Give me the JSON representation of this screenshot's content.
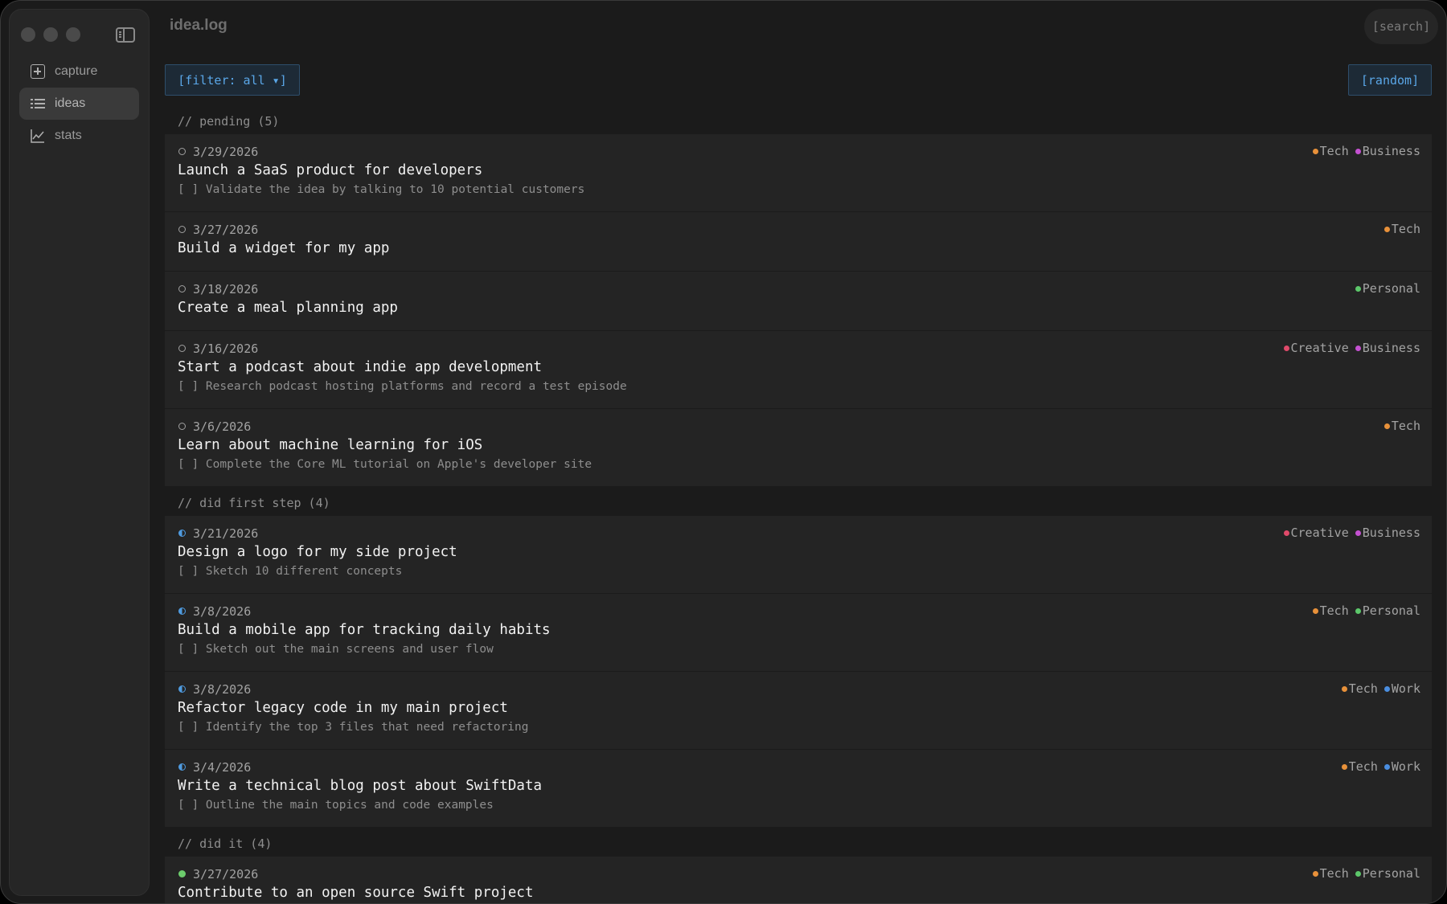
{
  "app": {
    "title": "idea.log",
    "search_label": "[search]"
  },
  "sidebar": {
    "items": [
      {
        "label": "capture",
        "icon": "capture-icon"
      },
      {
        "label": "ideas",
        "icon": "list-icon",
        "active": true
      },
      {
        "label": "stats",
        "icon": "chart-icon"
      }
    ]
  },
  "toolbar": {
    "filter_label": "[filter: all ▾]",
    "random_label": "[random]"
  },
  "tag_colors": {
    "Tech": "#e8913a",
    "Business": "#c451d1",
    "Personal": "#5cc76a",
    "Creative": "#e04a6a",
    "Work": "#4a8ee0"
  },
  "sections": [
    {
      "header": "// pending (5)",
      "status": "pending",
      "cards": [
        {
          "date": "3/29/2026",
          "title": "Launch a SaaS product for developers",
          "step": "[ ] Validate the idea by talking to 10 potential customers",
          "tags": [
            "Tech",
            "Business"
          ]
        },
        {
          "date": "3/27/2026",
          "title": "Build a widget for my app",
          "step": "",
          "tags": [
            "Tech"
          ]
        },
        {
          "date": "3/18/2026",
          "title": "Create a meal planning app",
          "step": "",
          "tags": [
            "Personal"
          ]
        },
        {
          "date": "3/16/2026",
          "title": "Start a podcast about indie app development",
          "step": "[ ] Research podcast hosting platforms and record a test episode",
          "tags": [
            "Creative",
            "Business"
          ]
        },
        {
          "date": "3/6/2026",
          "title": "Learn about machine learning for iOS",
          "step": "[ ] Complete the Core ML tutorial on Apple's developer site",
          "tags": [
            "Tech"
          ]
        }
      ]
    },
    {
      "header": "// did first step (4)",
      "status": "half",
      "cards": [
        {
          "date": "3/21/2026",
          "title": "Design a logo for my side project",
          "step": "[ ] Sketch 10 different concepts",
          "tags": [
            "Creative",
            "Business"
          ]
        },
        {
          "date": "3/8/2026",
          "title": "Build a mobile app for tracking daily habits",
          "step": "[ ] Sketch out the main screens and user flow",
          "tags": [
            "Tech",
            "Personal"
          ]
        },
        {
          "date": "3/8/2026",
          "title": "Refactor legacy code in my main project",
          "step": "[ ] Identify the top 3 files that need refactoring",
          "tags": [
            "Tech",
            "Work"
          ]
        },
        {
          "date": "3/4/2026",
          "title": "Write a technical blog post about SwiftData",
          "step": "[ ] Outline the main topics and code examples",
          "tags": [
            "Tech",
            "Work"
          ]
        }
      ]
    },
    {
      "header": "// did it (4)",
      "status": "done",
      "cards": [
        {
          "date": "3/27/2026",
          "title": "Contribute to an open source Swift project",
          "step": "",
          "tags": [
            "Tech",
            "Personal"
          ]
        }
      ]
    }
  ]
}
